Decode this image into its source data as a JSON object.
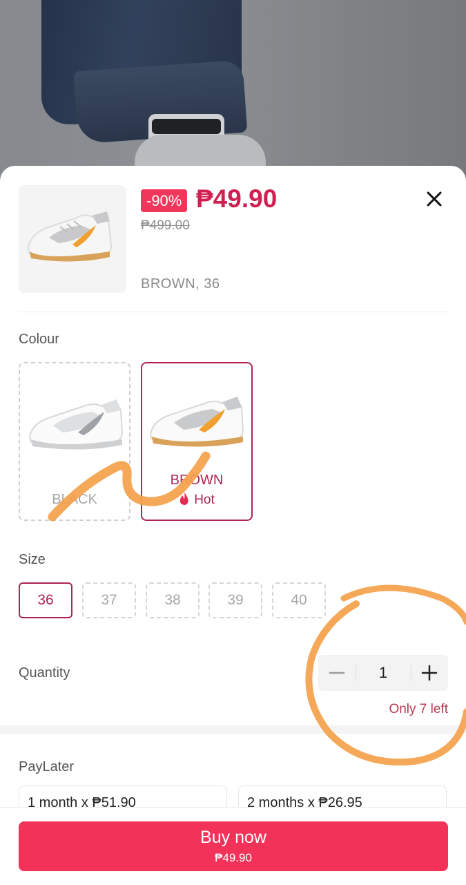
{
  "product": {
    "discount_badge": "-90%",
    "price": "₱49.90",
    "original_price": "₱499.00",
    "selected_variant": "BROWN, 36"
  },
  "colour": {
    "label": "Colour",
    "options": [
      {
        "name": "BLACK",
        "selected": false
      },
      {
        "name": "BROWN",
        "selected": true,
        "tag": "Hot"
      }
    ]
  },
  "size": {
    "label": "Size",
    "options": [
      "36",
      "37",
      "38",
      "39",
      "40"
    ],
    "selected": "36"
  },
  "quantity": {
    "label": "Quantity",
    "value": "1",
    "stock_note": "Only 7 left"
  },
  "paylater": {
    "label": "PayLater",
    "plans": [
      "1 month x ₱51.90",
      "2 months x ₱26.95"
    ]
  },
  "footer": {
    "buy_label": "Buy now",
    "buy_price": "₱49.90"
  },
  "colors": {
    "accent": "#f3325a",
    "selected_border": "#b0244f",
    "price": "#d0204f",
    "annotation": "#f4a14a"
  },
  "icons": [
    "close-icon",
    "flame-icon",
    "minus-icon",
    "plus-icon"
  ]
}
